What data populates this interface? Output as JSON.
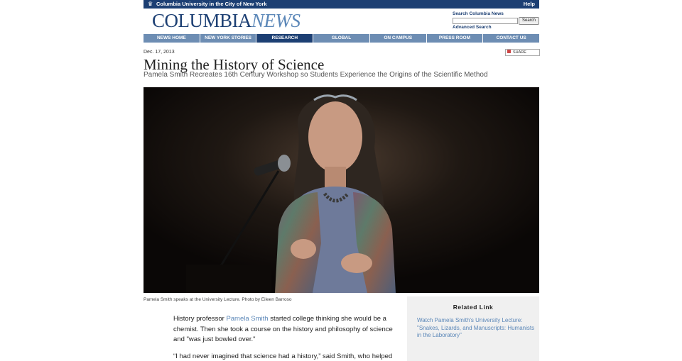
{
  "topbar": {
    "university": "Columbia University in the City of New York",
    "help": "Help"
  },
  "logo": {
    "part1": "COLUMBIA",
    "part2": "NEWS"
  },
  "search": {
    "label": "Search Columbia News",
    "value": "",
    "button": "Search",
    "advanced": "Advanced Search"
  },
  "nav": [
    {
      "label": "NEWS HOME",
      "active": false
    },
    {
      "label": "NEW YORK STORIES",
      "active": false
    },
    {
      "label": "RESEARCH",
      "active": true
    },
    {
      "label": "GLOBAL",
      "active": false
    },
    {
      "label": "ON CAMPUS",
      "active": false
    },
    {
      "label": "PRESS ROOM",
      "active": false
    },
    {
      "label": "CONTACT US",
      "active": false
    }
  ],
  "article": {
    "date": "Dec. 17, 2013",
    "share": "SHARE",
    "title": "Mining the History of Science",
    "subtitle": "Pamela Smith Recreates 16th Century Workshop so Students Experience the Origins of the Scientific Method",
    "caption": "Pamela Smith speaks at the University Lecture. Photo by Eileen Barroso",
    "p1_before": "History professor ",
    "p1_link": "Pamela Smith",
    "p1_after": " started college thinking she would be a chemist. Then she took a course on the history and philosophy of science and \"was just bowled over.\"",
    "p2": "“I had never imagined that science had a history,” said Smith, who helped"
  },
  "related": {
    "heading": "Related Link",
    "link": "Watch Pamela Smith's University Lecture: \"Snakes, Lizards, and Manuscripts: Humanists in the Laboratory\""
  },
  "colors": {
    "navy": "#1c3f73",
    "nav_blue": "#6d8db3",
    "link_blue": "#5b87b8"
  }
}
